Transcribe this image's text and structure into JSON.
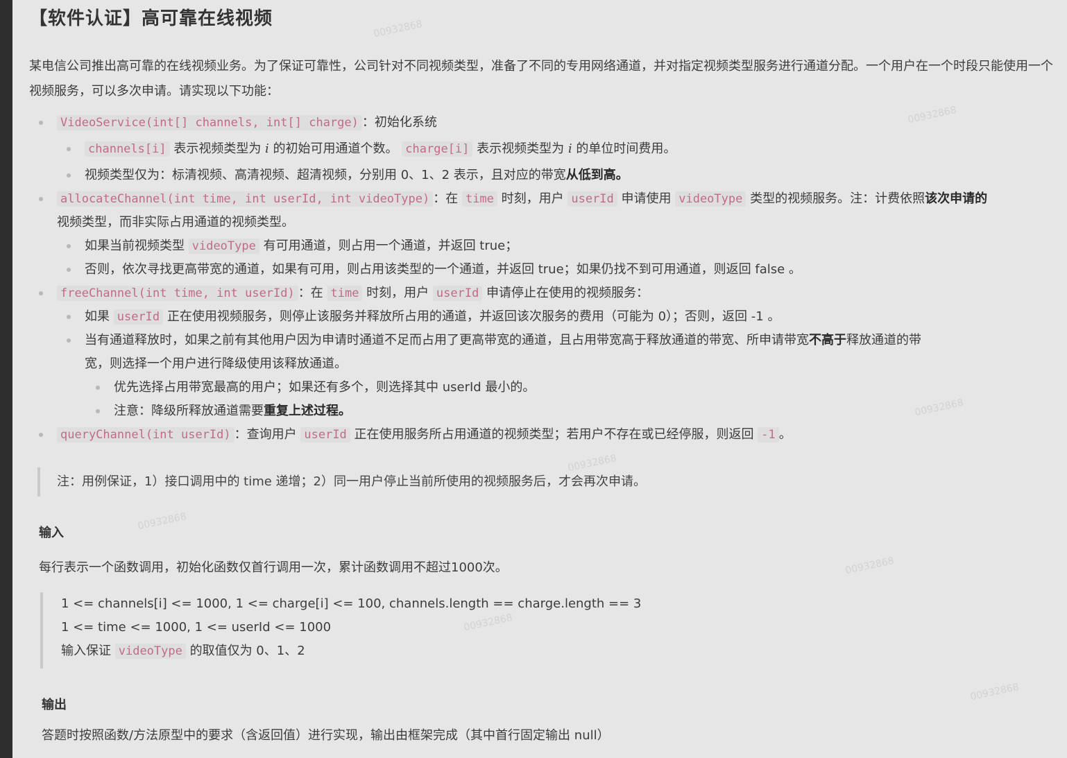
{
  "title": "【软件认证】高可靠在线视频",
  "intro": "某电信公司推出高可靠的在线视频业务。为了保证可靠性，公司针对不同视频类型，准备了不同的专用网络通道，并对指定视频类型服务进行通道分配。一个用户在一个时段只能使用一个视频服务，可以多次申请。请实现以下功能：",
  "items": {
    "init_code": "VideoService(int[] channels, int[] charge)",
    "init_text": "：初始化系统",
    "init_sub1_code1": "channels[i]",
    "init_sub1_t1": " 表示视频类型为 ",
    "init_sub1_i": "i",
    "init_sub1_t2": " 的初始可用通道个数。",
    "init_sub1_code2": "charge[i]",
    "init_sub1_t3": " 表示视频类型为 ",
    "init_sub1_t4": " 的单位时间费用。",
    "init_sub2_t": "视频类型仅为：标清视频、高清视频、超清视频，分别用 0、1、2 表示，且对应的带宽",
    "init_sub2_b": "从低到高。",
    "alloc_code": "allocateChannel(int time, int userId, int videoType)",
    "alloc_t1": "：在 ",
    "alloc_c_time": "time",
    "alloc_t2": " 时刻，用户 ",
    "alloc_c_user": "userId",
    "alloc_t3": " 申请使用 ",
    "alloc_c_vt": "videoType",
    "alloc_t4": " 类型的视频服务。注：计费依照",
    "alloc_b": "该次申请的",
    "alloc_t5": "视频类型，而非实际占用通道的视频类型。",
    "alloc_sub1_t1": "如果当前视频类型 ",
    "alloc_sub1_c": "videoType",
    "alloc_sub1_t2": " 有可用通道，则占用一个通道，并返回 true；",
    "alloc_sub2": "否则，依次寻找更高带宽的通道，如果有可用，则占用该类型的一个通道，并返回 true；如果仍找不到可用通道，则返回 false 。",
    "free_code": "freeChannel(int time, int userId)",
    "free_t1": "：在 ",
    "free_c_time": "time",
    "free_t2": " 时刻，用户 ",
    "free_c_user": "userId",
    "free_t3": " 申请停止在使用的视频服务：",
    "free_sub1_t1": "如果 ",
    "free_sub1_c": "userId",
    "free_sub1_t2": " 正在使用视频服务，则停止该服务并释放所占用的通道，并返回该次服务的费用（可能为 0）；否则，返回 -1 。",
    "free_sub2_t1": "当有通道释放时，如果之前有其他用户因为申请时通道不足而占用了更高带宽的通道，且占用带宽高于释放通道的带宽、所申请带宽",
    "free_sub2_b": "不高于",
    "free_sub2_t2": "释放通道的带",
    "free_sub2_t3": "宽，则选择一个用户进行降级使用该释放通道。",
    "free_sub3": "优先选择占用带宽最高的用户；如果还有多个，则选择其中 userId 最小的。",
    "free_sub4_t": "注意：降级所释放通道需要",
    "free_sub4_b": "重复上述过程。",
    "query_code": "queryChannel(int userId)",
    "query_t1": "：查询用户 ",
    "query_c_user": "userId",
    "query_t2": " 正在使用服务所占用通道的视频类型；若用户不存在或已经停服，则返回 ",
    "query_c_neg": "-1",
    "query_t3": "。"
  },
  "note": "注：用例保证，1）接口调用中的 time 递增；2）同一用户停止当前所使用的视频服务后，才会再次申请。",
  "input_heading": "输入",
  "input_desc": "每行表示一个函数调用，初始化函数仅首行调用一次，累计函数调用不超过1000次。",
  "constraints": {
    "line1": "1 <= channels[i] <= 1000, 1 <= charge[i] <= 100, channels.length == charge.length == 3",
    "line2": "1 <= time <= 1000, 1 <= userId <= 1000",
    "line3_t1": "输入保证 ",
    "line3_c": "videoType",
    "line3_t2": " 的取值仅为 0、1、2"
  },
  "output_heading": "输出",
  "output_desc": "答题时按照函数/方法原型中的要求（含返回值）进行实现，输出由框架完成（其中首行固定输出 null）",
  "watermark": "00932868"
}
